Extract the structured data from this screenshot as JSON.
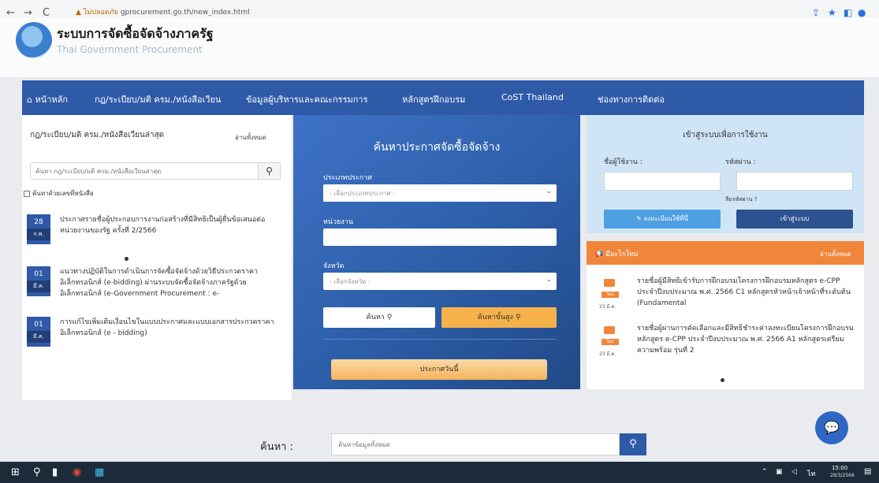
{
  "browser": {
    "back": "←",
    "forward": "→",
    "reload": "C",
    "security": "▲ ไม่ปลอดภัย",
    "url": "gprocurement.go.th/new_index.html"
  },
  "site": {
    "title_th": "ระบบการจัดซื้อจัดจ้างภาครัฐ",
    "title_en": "Thai Government Procurement"
  },
  "nav": {
    "home": "หน้าหลัก",
    "items": [
      "กฎ/ระเบียบ/มติ ครม./หนังสือเวียน",
      "ข้อมูลผู้บริหารและคณะกรรมการ",
      "หลักสูตรฝึกอบรม",
      "CoST Thailand",
      "ช่องทางการติดต่อ"
    ]
  },
  "news": {
    "heading": "กฎ/ระเบียบ/มติ ครม./หนังสือเวียนล่าสุด",
    "all_link": "อ่านทั้งหมด",
    "search_placeholder": "ค้นหา กฎ/ระเบียบ/มติ ครม./หนังสือเวียนล่าสุด",
    "checkbox_label": "ค้นหาด้วยเลขที่หนังสือ",
    "items": [
      {
        "day": "28",
        "month": "ก.พ.",
        "text": "ประกาศรายชื่อผู้ประกอบการงานก่อสร้างที่มีสิทธิเป็นผู้ยื่นข้อเสนอต่อหน่วยงานของรัฐ ครั้งที่ 2/2566"
      },
      {
        "day": "01",
        "month": "มี.ค.",
        "text": "แนวทางปฏิบัติในการดำเนินการจัดซื้อจัดจ้างด้วยวิธีประกวดราคาอิเล็กทรอนิกส์ (e-bidding) ผ่านระบบจัดซื้อจัดจ้างภาครัฐด้วยอิเล็กทรอนิกส์ (e-Government Procurement : e-"
      },
      {
        "day": "01",
        "month": "มี.ค.",
        "text": "การแก้ไขเพิ่มเติมเงื่อนไขในแบบประกาศและแบบเอกสารประกวดราคาอิเล็กทรอนิกส์ (e - bidding)"
      }
    ]
  },
  "search_panel": {
    "title": "ค้นหาประกาศจัดซื้อจัดจ้าง",
    "type_label": "ประเภทประกาศ",
    "type_placeholder": "- เลือกประเภทประกาศ -",
    "agency_label": "หน่วยงาน",
    "province_label": "จังหวัด",
    "province_placeholder": "- เลือกจังหวัด -",
    "search_btn": "ค้นหา",
    "advanced_btn": "ค้นหาขั้นสูง",
    "today_btn": "ประกาศวันนี้"
  },
  "login": {
    "title": "เข้าสู่ระบบเพื่อการใช้งาน",
    "username_label": "ชื่อผู้ใช้งาน :",
    "password_label": "รหัสผ่าน :",
    "forgot": "ลืมรหัสผ่าน ?",
    "register_btn": "ลงทะเบียนใช้ที่นี่",
    "login_btn": "เข้าสู่ระบบ"
  },
  "whats_new": {
    "label": "มีอะไรใหม่",
    "all_link": "อ่านทั้งหมด",
    "items": [
      {
        "tag": "ใหม่",
        "date": "23 มี.ค.",
        "text": "รายชื่อผู้มีสิทธิเข้ารับการฝึกอบรมโครงการฝึกอบรมหลักสูตร e-CPP ประจำปีงบประมาณ พ.ศ. 2566 C1 หลักสูตรหัวหน้าเจ้าหน้าที่ระดับต้น (Fundamental"
      },
      {
        "tag": "ใหม่",
        "date": "23 มี.ค.",
        "text": "รายชื่อผู้ผ่านการคัดเลือกและมีสิทธิชำระค่าลงทะเบียนโครงการฝึกอบรมหลักสูตร e-CPP ประจำปีงบประมาณ พ.ศ. 2566 A1 หลักสูตรเตรียมความพร้อม รุ่นที่ 2"
      }
    ]
  },
  "bottom_search": {
    "label": "ค้นหา :",
    "placeholder": "ค้นหาข้อมูลทั้งหมด"
  },
  "taskbar": {
    "time": "15:00",
    "date": "28/3/2566"
  }
}
